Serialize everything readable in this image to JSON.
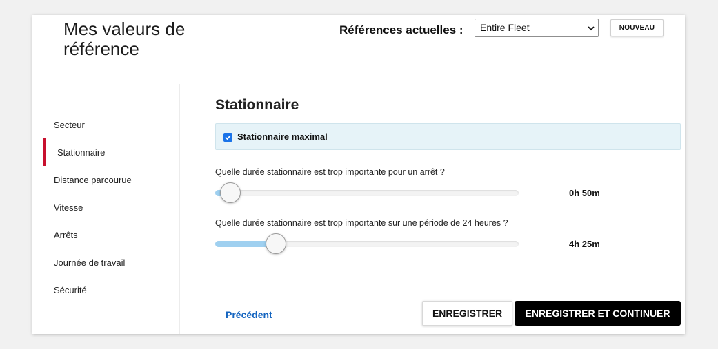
{
  "header": {
    "title": "Mes valeurs de référence",
    "references_label": "Références actuelles :",
    "fleet_select_value": "Entire Fleet",
    "new_button_label": "NOUVEAU"
  },
  "sidebar": {
    "active_color": "#c8102e",
    "items": [
      {
        "label": "Secteur",
        "active": false
      },
      {
        "label": "Stationnaire",
        "active": true
      },
      {
        "label": "Distance parcourue",
        "active": false
      },
      {
        "label": "Vitesse",
        "active": false
      },
      {
        "label": "Arrêts",
        "active": false
      },
      {
        "label": "Journée de travail",
        "active": false
      },
      {
        "label": "Sécurité",
        "active": false
      }
    ]
  },
  "main": {
    "section_title": "Stationnaire",
    "checkbox": {
      "label": "Stationnaire maximal",
      "checked": true
    },
    "sliders": [
      {
        "question": "Quelle durée stationnaire est trop importante pour un arrêt ?",
        "value_label": "0h 50m",
        "level_percent": 5
      },
      {
        "question": "Quelle durée stationnaire est trop importante sur une période de 24 heures ?",
        "value_label": "4h 25m",
        "level_percent": 20
      }
    ]
  },
  "footer": {
    "prev_label": "Précédent",
    "save_label": "ENREGISTRER",
    "save_continue_label": "ENREGISTRER ET CONTINUER"
  },
  "colors": {
    "accent": "#c8102e",
    "link": "#1565c0",
    "slider_fill": "#9fd0f0",
    "panel_bg": "#e6f3f8"
  }
}
